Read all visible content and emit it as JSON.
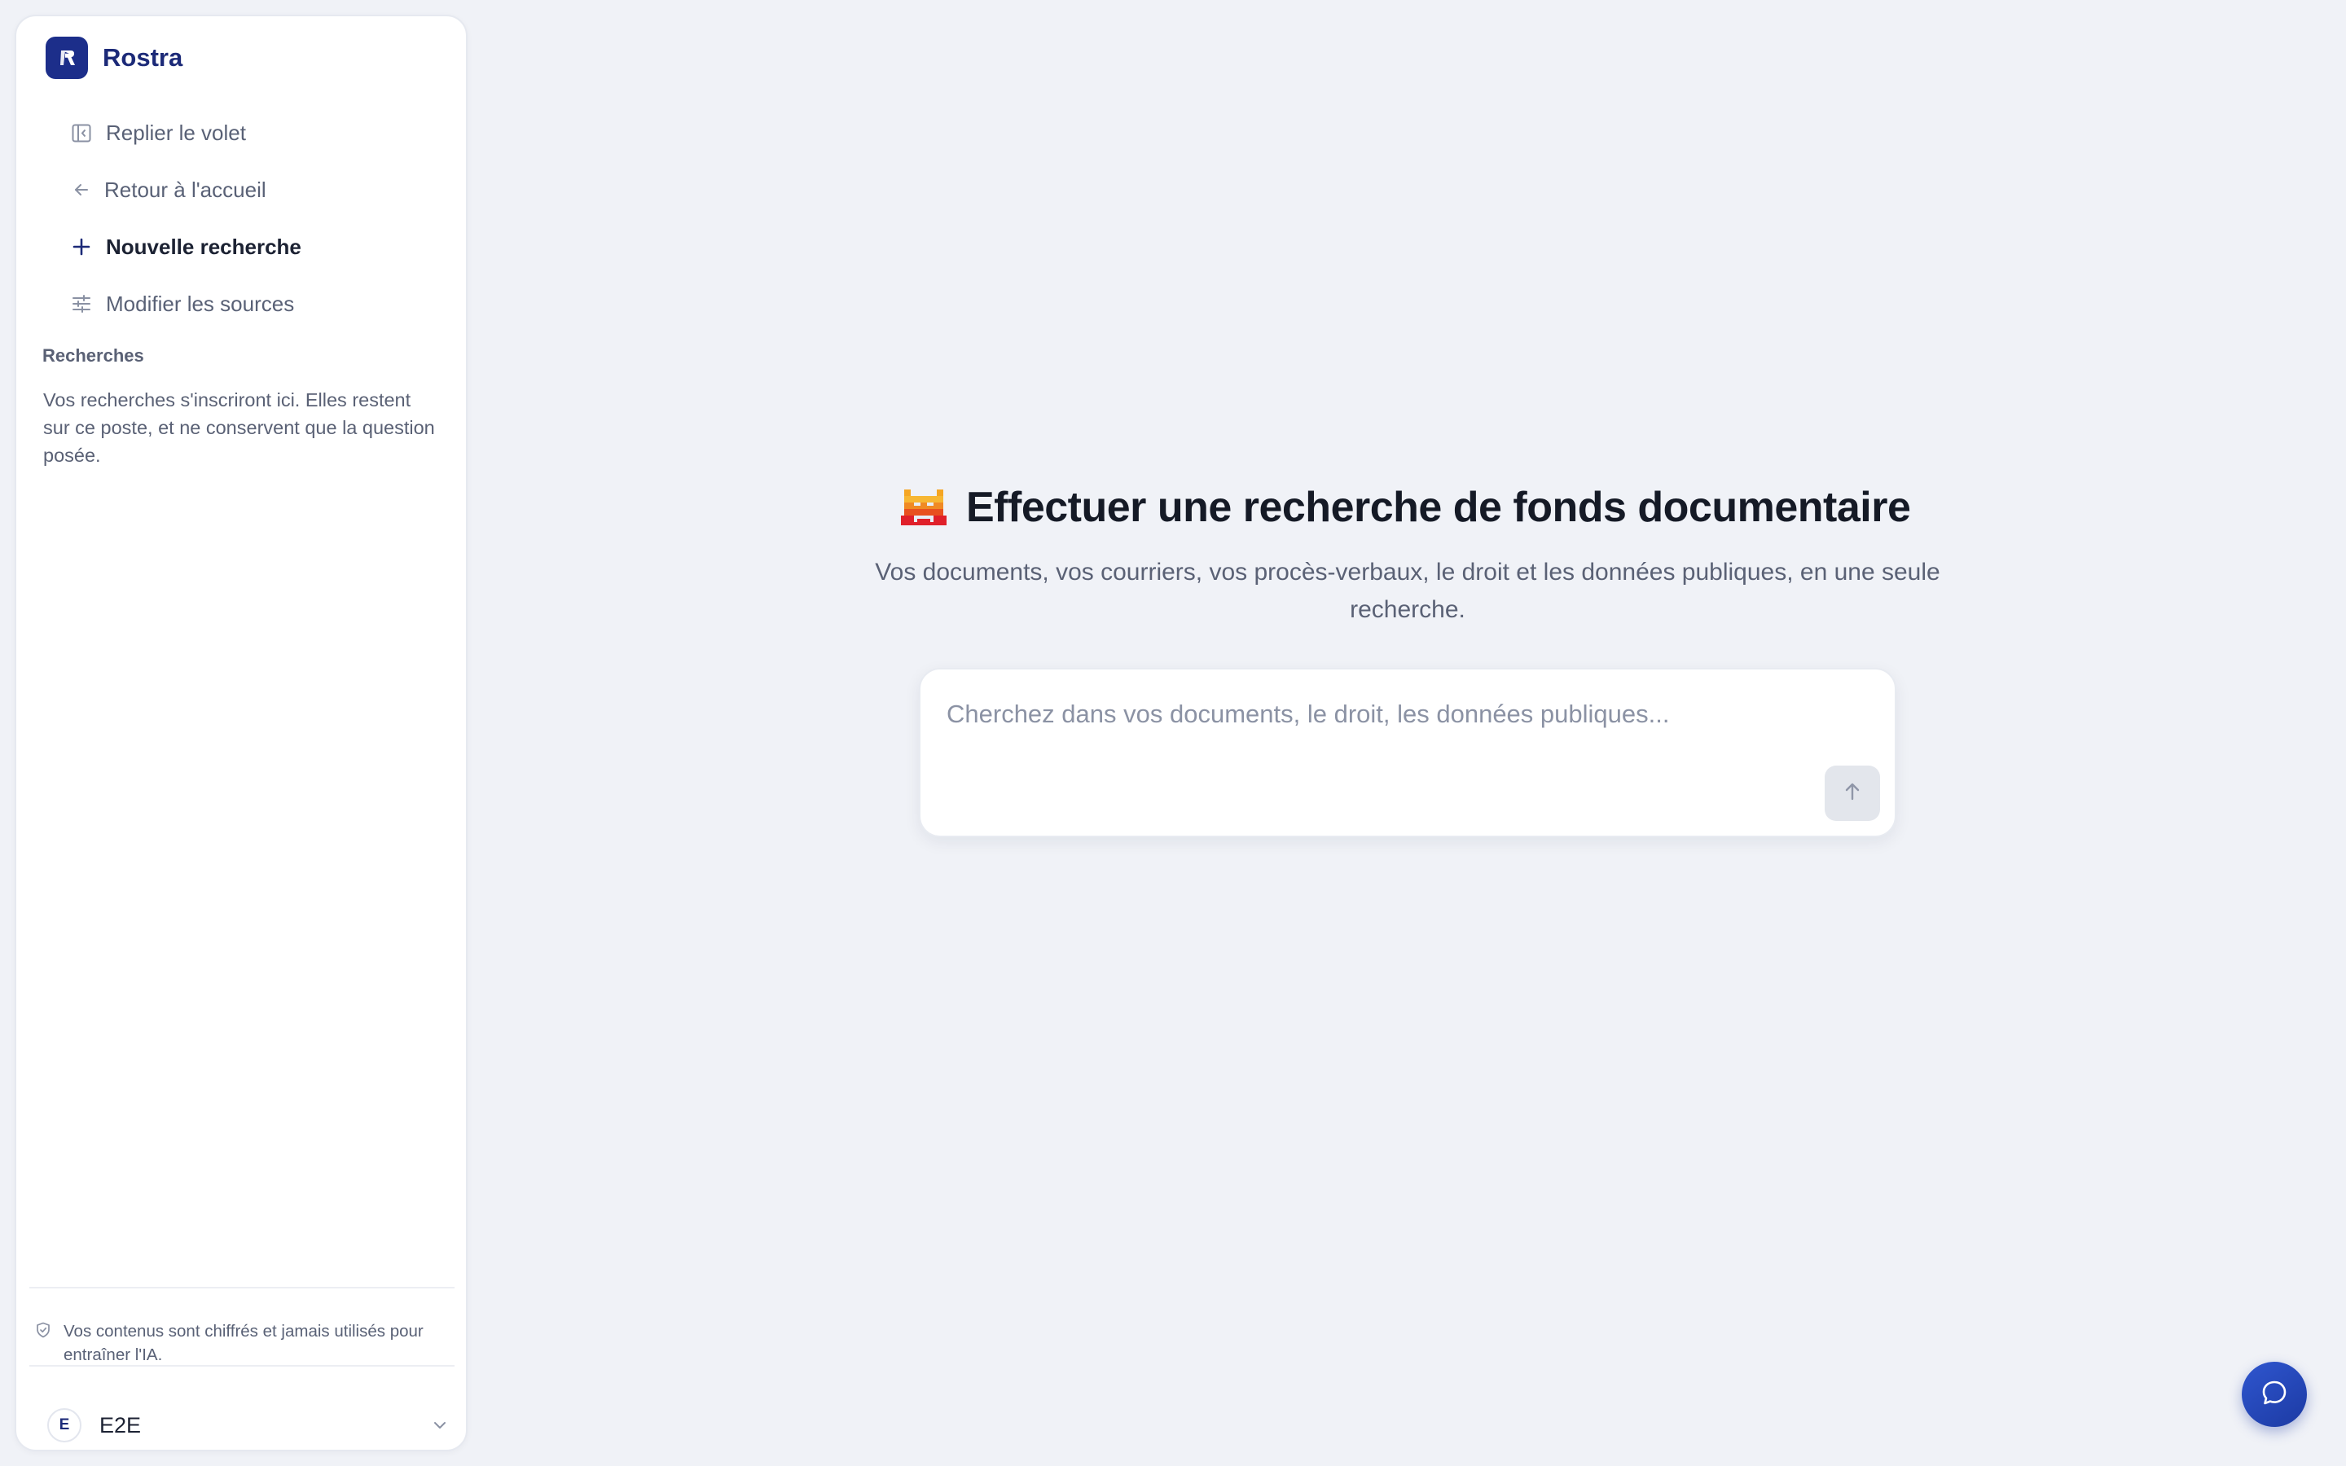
{
  "app": {
    "name": "Rostra"
  },
  "sidebar": {
    "items": [
      {
        "label": "Replier le volet",
        "icon": "collapse-panel-icon"
      },
      {
        "label": "Retour à l'accueil",
        "icon": "arrow-left-icon"
      },
      {
        "label": "Nouvelle recherche",
        "icon": "plus-icon"
      },
      {
        "label": "Modifier les sources",
        "icon": "sliders-icon"
      }
    ],
    "history": {
      "title": "Recherches",
      "empty_text": "Vos recherches s'inscriront ici. Elles restent sur ce poste, et ne conservent que la question posée."
    },
    "privacy_note": "Vos contenus sont chiffrés et jamais utilisés pour entraîner l'IA.",
    "account": {
      "initial": "E",
      "name": "E2E"
    }
  },
  "main": {
    "title": "Effectuer une recherche de fonds documentaire",
    "subtitle": "Vos documents, vos courriers, vos procès-verbaux, le droit et les données publiques, en une seule recherche.",
    "search": {
      "placeholder": "Cherchez dans vos documents, le droit, les données publiques...",
      "value": ""
    }
  },
  "colors": {
    "brand": "#1c2e8a",
    "background": "#f0f2f7",
    "chat_button": "#2446b8"
  }
}
